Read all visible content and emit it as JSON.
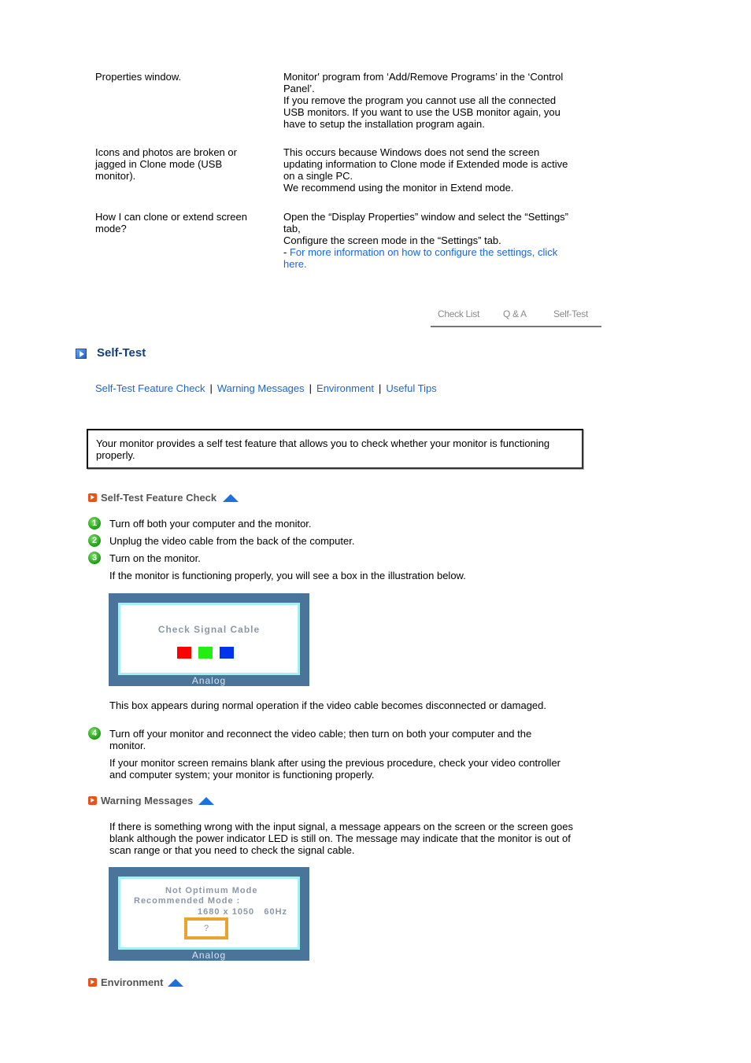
{
  "faq": [
    {
      "question": "Properties window.",
      "answer_lines": [
        "Monitor' program from ‘Add/Remove Programs’ in the ‘Control",
        "Panel’.",
        "If you remove the program you cannot use all the connected",
        "USB monitors. If you want to use the USB monitor again, you",
        "have to setup the installation program again."
      ]
    },
    {
      "question_lines": [
        "Icons and photos are broken or",
        "jagged in Clone mode (USB",
        "monitor)."
      ],
      "answer_lines": [
        "This occurs because Windows does not send the screen",
        "updating information to Clone mode if Extended mode is active",
        "on a single PC.",
        "We recommend using the monitor in Extend mode."
      ]
    },
    {
      "question_lines": [
        "How I can clone or extend screen",
        "mode?"
      ],
      "answer_lines": [
        "Open the “Display Properties” window and select the “Settings”",
        "tab,",
        "Configure the screen mode in the “Settings” tab."
      ],
      "answer_link_prefix": "- ",
      "answer_link_lines": [
        "For more information on how to configure the settings, click",
        "here."
      ]
    }
  ],
  "tabs": [
    {
      "label": "Check List"
    },
    {
      "label": "Q & A"
    },
    {
      "label": "Self-Test"
    }
  ],
  "section": {
    "title": "Self-Test",
    "icon": "play-icon",
    "subnav": [
      "Self-Test Feature Check",
      "Warning Messages",
      "Environment",
      "Useful Tips"
    ],
    "subnav_separator": "|",
    "intro": "Your monitor provides a self test feature that allows you to check whether your monitor is functioning properly."
  },
  "feature_check": {
    "heading": "Self-Test Feature Check",
    "steps": [
      {
        "num": "1",
        "text": "Turn off both your computer and the monitor."
      },
      {
        "num": "2",
        "text": "Unplug the video cable from the back of the computer."
      },
      {
        "num": "3",
        "text": "Turn on the monitor."
      }
    ],
    "step3_note": "If the monitor is functioning properly, you will see a box in the illustration below.",
    "osd1": {
      "message": "Check Signal Cable",
      "label": "Analog",
      "colors": [
        "#ff0000",
        "#22ee11",
        "#0033ee"
      ]
    },
    "osd1_caption": "This box appears during normal operation if the video cable becomes disconnected or damaged.",
    "step4": {
      "num": "4",
      "text": "Turn off your monitor and reconnect the video cable; then turn on both your computer and the monitor."
    },
    "step4_note": "If your monitor screen remains blank after using the previous procedure, check your video controller and computer system; your monitor is functioning properly."
  },
  "warning": {
    "heading": "Warning Messages",
    "text": "If there is something wrong with the input signal, a message appears on the screen or the screen goes blank although the power indicator LED is still on. The message may indicate that the monitor is out of scan range or that you need to check the signal cable.",
    "osd2": {
      "line1": "Not Optimum Mode",
      "line2": "Recommended Mode :",
      "line3": "1680 x 1050   60Hz",
      "button": "?",
      "label": "Analog"
    }
  },
  "environment": {
    "heading": "Environment"
  }
}
